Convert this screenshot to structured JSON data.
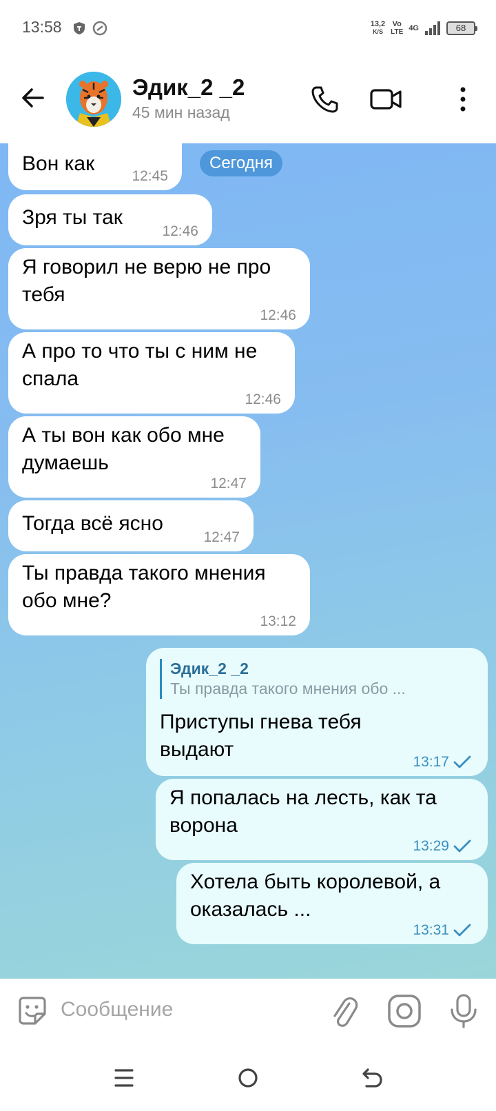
{
  "status_bar": {
    "time": "13:58",
    "net_speed": "13,2",
    "net_unit": "K/S",
    "volte_top": "Vo",
    "volte_bottom": "LTE",
    "network": "4G",
    "battery": "68"
  },
  "header": {
    "contact_name": "Эдик_2 _2",
    "last_seen": "45 мин назад"
  },
  "chat": {
    "date_label": "Сегодня",
    "incoming": [
      {
        "text": "Вон как",
        "time": "12:45"
      },
      {
        "text": "Зря ты так",
        "time": "12:46"
      },
      {
        "text": "Я говорил не верю не про тебя",
        "time": "12:46"
      },
      {
        "text": "А про то что ты с ним не спала",
        "time": "12:46"
      },
      {
        "text": "А ты вон как обо мне думаешь",
        "time": "12:47"
      },
      {
        "text": "Тогда всё ясно",
        "time": "12:47"
      },
      {
        "text": "Ты правда такого мнения обо мне?",
        "time": "13:12"
      }
    ],
    "outgoing": [
      {
        "reply_name": "Эдик_2 _2",
        "reply_text": "Ты правда такого мнения обо ...",
        "text": "Приступы гнева тебя выдают",
        "time": "13:17"
      },
      {
        "text": "Я попалась на лесть, как та ворона",
        "time": "13:29"
      },
      {
        "text": "Хотела быть королевой, а оказалась ...",
        "time": "13:31"
      }
    ]
  },
  "input": {
    "placeholder": "Сообщение"
  },
  "colors": {
    "accent": "#2a8bbf",
    "outgoing_bubble": "#e8fbfd",
    "incoming_bubble": "#ffffff"
  }
}
